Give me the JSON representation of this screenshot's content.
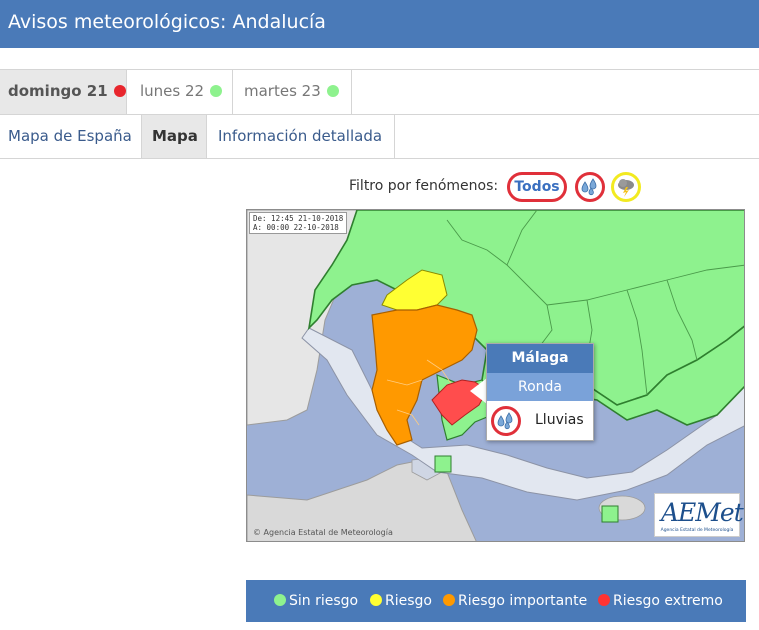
{
  "header": {
    "title": "Avisos meteorológicos: Andalucía"
  },
  "day_tabs": [
    {
      "label": "domingo 21",
      "level": "red",
      "active": true
    },
    {
      "label": "lunes 22",
      "level": "green",
      "active": false
    },
    {
      "label": "martes 23",
      "level": "green",
      "active": false
    }
  ],
  "view_tabs": [
    {
      "label": "Mapa de España",
      "active": false
    },
    {
      "label": "Mapa",
      "active": true
    },
    {
      "label": "Información detallada",
      "active": false
    }
  ],
  "filter": {
    "label": "Filtro por fenómenos:",
    "all_label": "Todos",
    "icons": [
      "rain-icon",
      "thunderstorm-icon"
    ]
  },
  "map": {
    "date_lines": [
      "De: 12:45 21-10-2018",
      "A:  00:00 22-10-2018"
    ],
    "credit": "Agencia Estatal de Meteorología",
    "logo_main": "AEMet",
    "logo_sub": "Agencia Estatal de Meteorología"
  },
  "popup": {
    "province": "Málaga",
    "zone": "Ronda",
    "phenomenon": "Lluvias",
    "phenomenon_icon": "rain-icon"
  },
  "legend": [
    {
      "label": "Sin riesgo",
      "color": "#8ef28e"
    },
    {
      "label": "Riesgo",
      "color": "#ffff33"
    },
    {
      "label": "Riesgo importante",
      "color": "#ff9900"
    },
    {
      "label": "Riesgo extremo",
      "color": "#ff3333"
    }
  ],
  "colors": {
    "header_bg": "#4a7ab8",
    "level_green": "#8ef28e",
    "level_yellow": "#ffff33",
    "level_orange": "#ff9900",
    "level_red": "#ff3333",
    "sea": "#9eb0d6",
    "portugal_land": "#e6e6e6",
    "africa_land": "#d9d9d9",
    "coastal_zone": "#e2e7f0"
  }
}
